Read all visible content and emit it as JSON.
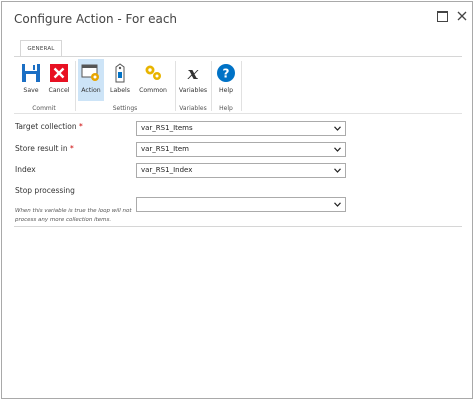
{
  "window": {
    "title": "Configure Action - For each"
  },
  "ribbon": {
    "tab": "GENERAL",
    "groups": [
      {
        "label": "Commit"
      },
      {
        "label": "Settings"
      },
      {
        "label": "Variables"
      },
      {
        "label": "Help"
      }
    ],
    "buttons": {
      "save": "Save",
      "cancel": "Cancel",
      "action": "Action",
      "labels": "Labels",
      "common": "Common",
      "variables": "Variables",
      "help": "Help"
    },
    "colors": {
      "accent": "#0072c6",
      "cancel": "#e81123",
      "active_bg": "#cde4f7"
    }
  },
  "form": {
    "target_collection": {
      "label": "Target collection",
      "required": "*",
      "value": "var_RS1_Items"
    },
    "store_result": {
      "label": "Store result in",
      "required": "*",
      "value": "var_RS1_Item"
    },
    "index": {
      "label": "Index",
      "value": "var_RS1_Index"
    },
    "stop_processing": {
      "label": "Stop processing",
      "note": "When this variable is true the loop will not process any more collection items.",
      "value": ""
    }
  }
}
